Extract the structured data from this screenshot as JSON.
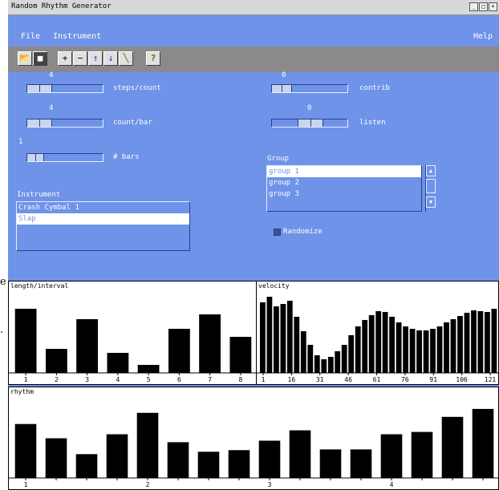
{
  "side_fragments": [
    "e",
    "."
  ],
  "window": {
    "title": "Random Rhythm Generator",
    "controls": [
      "_",
      "□",
      "×"
    ]
  },
  "menu": {
    "file": "File",
    "instrument": "Instrument",
    "help": "Help"
  },
  "toolbar": {
    "buttons": [
      {
        "icon": "open-folder-icon",
        "glyph": "📂"
      },
      {
        "icon": "save-disk-icon",
        "glyph": "■"
      },
      {
        "icon": "add-icon",
        "glyph": "+"
      },
      {
        "icon": "remove-icon",
        "glyph": "−"
      },
      {
        "icon": "move-up-icon",
        "glyph": "↑"
      },
      {
        "icon": "move-down-icon",
        "glyph": "↓"
      },
      {
        "icon": "wand-icon",
        "glyph": "╲"
      },
      {
        "icon": "help-icon",
        "glyph": "?"
      }
    ]
  },
  "controls": {
    "steps_count": {
      "value": "4",
      "label": "steps/count",
      "level": 0.3
    },
    "count_bar": {
      "value": "4",
      "label": "count/bar",
      "level": 0.3
    },
    "bars": {
      "value": "1",
      "label": "# bars",
      "level": 0.1
    },
    "contrib": {
      "value": "0",
      "label": "contrib",
      "level": 0.05
    },
    "listen": {
      "value": "0",
      "label": "listen",
      "level": 0.5
    }
  },
  "instrument": {
    "label": "Instrument",
    "items": [
      "Crash Cymbal 1",
      "Slap"
    ],
    "selected": 1
  },
  "group": {
    "label": "Group",
    "items": [
      "group 1",
      "group 2",
      "group 3"
    ],
    "selected": 0
  },
  "randomize": {
    "label": "Randomize",
    "checked": true
  },
  "chart_data": [
    {
      "type": "bar",
      "title": "length/interval",
      "categories": [
        "1",
        "2",
        "3",
        "4",
        "5",
        "6",
        "7",
        "8"
      ],
      "values": [
        0.8,
        0.3,
        0.67,
        0.25,
        0.1,
        0.55,
        0.73,
        0.45
      ],
      "ylim": [
        0,
        1
      ]
    },
    {
      "type": "bar",
      "title": "velocity",
      "x": [
        1,
        2,
        3,
        4,
        5,
        6,
        7,
        8,
        9,
        10,
        11,
        12,
        13,
        14,
        15,
        16,
        17,
        18,
        19,
        20,
        21,
        22,
        23,
        24,
        25,
        26,
        27,
        28,
        29,
        30,
        31,
        32,
        33,
        34,
        35,
        36,
        37,
        38,
        39,
        40,
        41,
        42,
        43,
        44,
        45,
        46,
        47,
        48,
        49,
        50,
        51,
        52,
        53,
        54,
        55,
        56,
        57,
        58,
        59,
        60,
        61,
        62,
        63,
        64,
        65,
        66,
        67,
        68,
        69,
        70,
        71,
        72,
        73,
        74,
        75,
        76,
        77,
        78,
        79,
        80,
        81,
        82,
        83,
        84,
        85,
        86,
        87,
        88,
        89,
        90,
        91,
        92,
        93,
        94,
        95,
        96,
        97,
        98,
        99,
        100,
        101,
        102,
        103,
        104,
        105,
        106,
        107,
        108,
        109,
        110,
        111,
        112,
        113,
        114,
        115,
        116,
        117,
        118,
        119,
        120,
        121,
        122,
        123,
        124,
        125,
        126,
        127,
        128
      ],
      "tick_labels": [
        "1",
        "16",
        "31",
        "46",
        "61",
        "76",
        "91",
        "106",
        "121"
      ],
      "values": [
        0.88,
        0.95,
        0.83,
        0.86,
        0.9,
        0.7,
        0.52,
        0.35,
        0.22,
        0.17,
        0.2,
        0.27,
        0.35,
        0.47,
        0.58,
        0.66,
        0.72,
        0.77,
        0.76,
        0.7,
        0.63,
        0.58,
        0.55,
        0.53,
        0.53,
        0.55,
        0.58,
        0.63,
        0.67,
        0.71,
        0.75,
        0.78,
        0.77,
        0.76,
        0.8
      ],
      "ylim": [
        0,
        1
      ]
    },
    {
      "type": "bar",
      "title": "rhythm",
      "categories": [
        "1",
        "",
        "",
        "",
        "2",
        "",
        "",
        "",
        "3",
        "",
        "",
        "",
        "4",
        "",
        "",
        ""
      ],
      "values": [
        0.68,
        0.5,
        0.3,
        0.55,
        0.82,
        0.45,
        0.33,
        0.35,
        0.47,
        0.6,
        0.36,
        0.36,
        0.55,
        0.58,
        0.77,
        0.87
      ],
      "ylim": [
        0,
        1
      ]
    }
  ]
}
